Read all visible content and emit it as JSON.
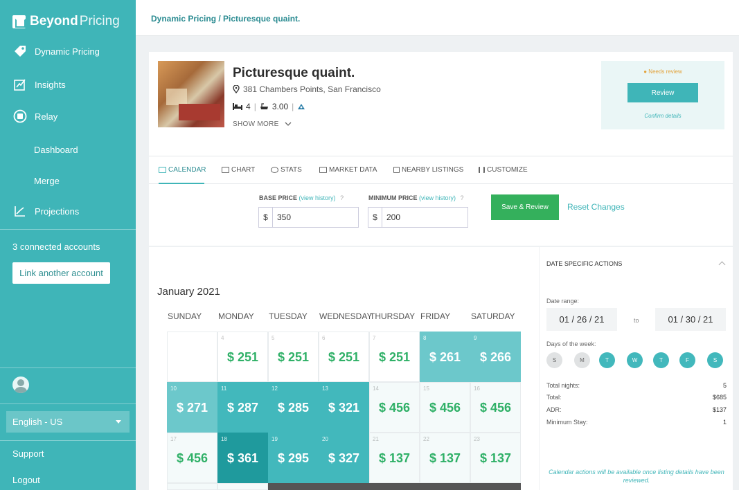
{
  "sidebar": {
    "brand_bold": "Beyond",
    "brand_light": "Pricing",
    "nav": [
      {
        "label": "Dynamic Pricing",
        "icon": "tag-icon"
      },
      {
        "label": "Insights",
        "icon": "insights-chart-icon"
      },
      {
        "label": "Relay",
        "icon": "relay-icon"
      },
      {
        "label": "Dashboard"
      },
      {
        "label": "Merge"
      },
      {
        "label": "Projections",
        "icon": "projections-icon"
      }
    ],
    "connected": "3 connected accounts",
    "link_button": "Link another account",
    "language": "English - US",
    "support": "Support",
    "logout": "Logout"
  },
  "breadcrumb": "Dynamic Pricing / Picturesque quaint.",
  "listing": {
    "title": "Picturesque quaint.",
    "address": "381 Chambers Points, San Francisco",
    "beds": "4",
    "baths": "3.00",
    "show_more": "SHOW MORE"
  },
  "review": {
    "status": "● Needs review",
    "button": "Review",
    "confirm": "Confirm details"
  },
  "tabs": [
    "CALENDAR",
    "CHART",
    "STATS",
    "MARKET DATA",
    "NEARBY LISTINGS",
    "CUSTOMIZE"
  ],
  "pricing": {
    "base_label": "BASE PRICE",
    "min_label": "MINIMUM PRICE",
    "view_history": "(view history)",
    "help": "?",
    "currency": "$",
    "base_value": "350",
    "min_value": "200",
    "save_button": "Save & Review",
    "reset": "Reset Changes"
  },
  "calendar": {
    "month": "January 2021",
    "days": [
      "SUNDAY",
      "MONDAY",
      "TUESDAY",
      "WEDNESDAY",
      "THURSDAY",
      "FRIDAY",
      "SATURDAY"
    ],
    "weeks": [
      [
        {
          "d": "",
          "p": ""
        },
        {
          "d": "4",
          "p": "$ 251"
        },
        {
          "d": "5",
          "p": "$ 251"
        },
        {
          "d": "6",
          "p": "$ 251"
        },
        {
          "d": "7",
          "p": "$ 251"
        },
        {
          "d": "8",
          "p": "$ 261"
        },
        {
          "d": "9",
          "p": "$ 266"
        }
      ],
      [
        {
          "d": "10",
          "p": "$ 271"
        },
        {
          "d": "11",
          "p": "$ 287"
        },
        {
          "d": "12",
          "p": "$ 285"
        },
        {
          "d": "13",
          "p": "$ 321"
        },
        {
          "d": "14",
          "p": "$ 456"
        },
        {
          "d": "15",
          "p": "$ 456"
        },
        {
          "d": "16",
          "p": "$ 456"
        }
      ],
      [
        {
          "d": "17",
          "p": "$ 456"
        },
        {
          "d": "18",
          "p": "$ 361"
        },
        {
          "d": "19",
          "p": "$ 295"
        },
        {
          "d": "20",
          "p": "$ 327"
        },
        {
          "d": "21",
          "p": "$ 137"
        },
        {
          "d": "22",
          "p": "$ 137"
        },
        {
          "d": "23",
          "p": "$ 137"
        }
      ]
    ]
  },
  "actions": {
    "title": "DATE SPECIFIC ACTIONS",
    "date_range_label": "Date range:",
    "from": "01 / 26 / 21",
    "to_label": "to",
    "to": "01 / 30 / 21",
    "days_label": "Days of the week:",
    "weekdays": [
      {
        "l": "S",
        "on": false
      },
      {
        "l": "M",
        "on": false
      },
      {
        "l": "T",
        "on": true
      },
      {
        "l": "W",
        "on": true
      },
      {
        "l": "T",
        "on": true
      },
      {
        "l": "F",
        "on": true
      },
      {
        "l": "S",
        "on": true
      }
    ],
    "stats": [
      {
        "label": "Total nights:",
        "value": "5"
      },
      {
        "label": "Total:",
        "value": "$685"
      },
      {
        "label": "ADR:",
        "value": "$137"
      },
      {
        "label": "Minimum Stay:",
        "value": "1"
      }
    ],
    "note": "Calendar actions will be available once listing details have been reviewed."
  },
  "colors": {
    "accent": "#3fb5b8",
    "green": "#34b05c",
    "warning": "#e3a23a"
  }
}
